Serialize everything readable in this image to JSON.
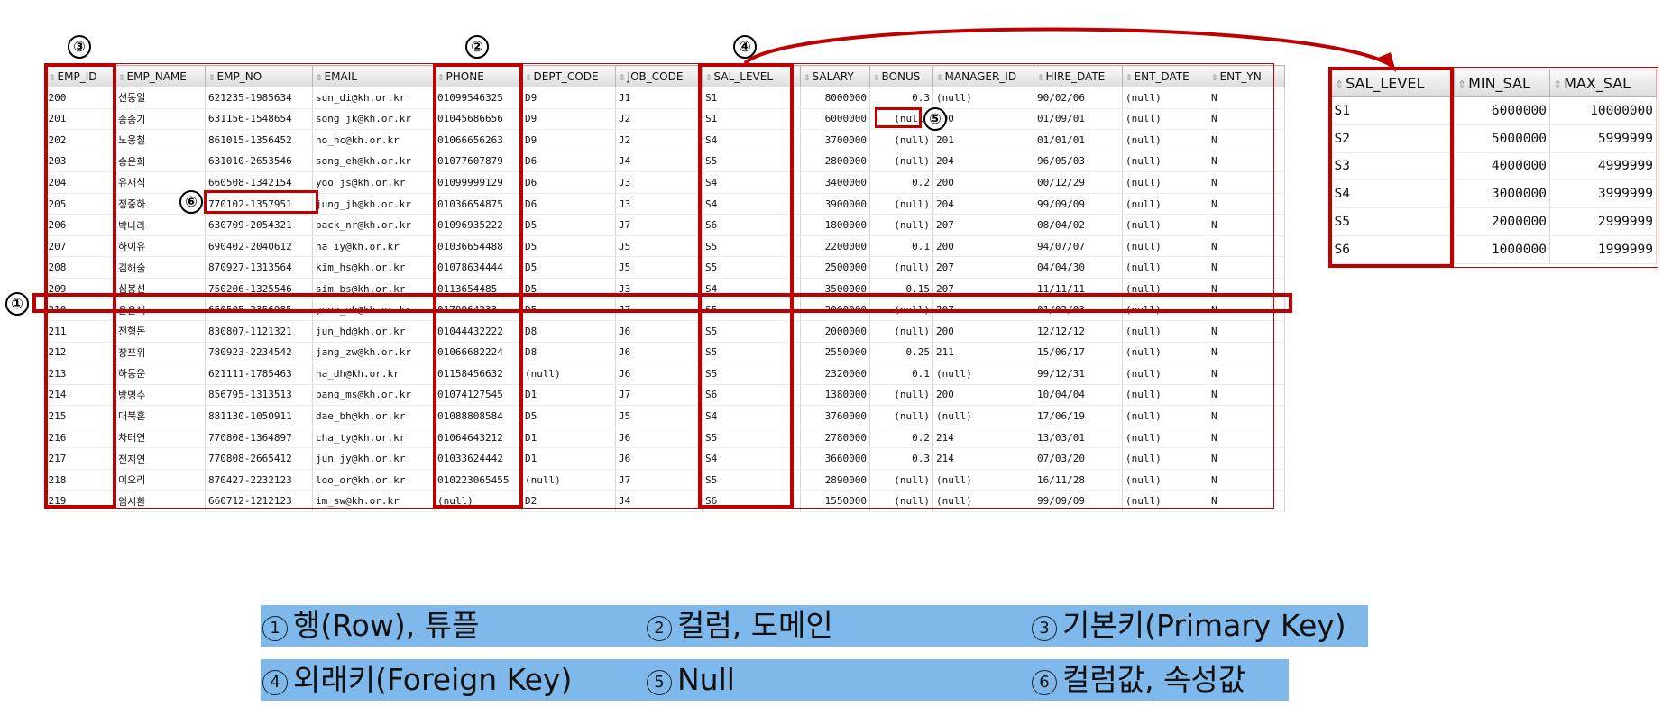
{
  "employee_table": {
    "columns": [
      "EMP_ID",
      "EMP_NAME",
      "EMP_NO",
      "EMAIL",
      "PHONE",
      "DEPT_CODE",
      "JOB_CODE",
      "SAL_LEVEL",
      "SALARY",
      "BONUS",
      "MANAGER_ID",
      "HIRE_DATE",
      "ENT_DATE",
      "ENT_YN"
    ],
    "rows": [
      [
        "200",
        "선동일",
        "621235-1985634",
        "sun_di@kh.or.kr",
        "01099546325",
        "D9",
        "J1",
        "S1",
        "8000000",
        "0.3",
        "(null)",
        "90/02/06",
        "(null)",
        "N"
      ],
      [
        "201",
        "송종기",
        "631156-1548654",
        "song_jk@kh.or.kr",
        "01045686656",
        "D9",
        "J2",
        "S1",
        "6000000",
        "(null)",
        "200",
        "01/09/01",
        "(null)",
        "N"
      ],
      [
        "202",
        "노옹철",
        "861015-1356452",
        "no_hc@kh.or.kr",
        "01066656263",
        "D9",
        "J2",
        "S4",
        "3700000",
        "(null)",
        "201",
        "01/01/01",
        "(null)",
        "N"
      ],
      [
        "203",
        "송은희",
        "631010-2653546",
        "song_eh@kh.or.kr",
        "01077607879",
        "D6",
        "J4",
        "S5",
        "2800000",
        "(null)",
        "204",
        "96/05/03",
        "(null)",
        "N"
      ],
      [
        "204",
        "유재식",
        "660508-1342154",
        "yoo_js@kh.or.kr",
        "01099999129",
        "D6",
        "J3",
        "S4",
        "3400000",
        "0.2",
        "200",
        "00/12/29",
        "(null)",
        "N"
      ],
      [
        "205",
        "정중하",
        "770102-1357951",
        "jung_jh@kh.or.kr",
        "01036654875",
        "D6",
        "J3",
        "S4",
        "3900000",
        "(null)",
        "204",
        "99/09/09",
        "(null)",
        "N"
      ],
      [
        "206",
        "박나라",
        "630709-2054321",
        "pack_nr@kh.or.kr",
        "01096935222",
        "D5",
        "J7",
        "S6",
        "1800000",
        "(null)",
        "207",
        "08/04/02",
        "(null)",
        "N"
      ],
      [
        "207",
        "하이유",
        "690402-2040612",
        "ha_iy@kh.or.kr",
        "01036654488",
        "D5",
        "J5",
        "S5",
        "2200000",
        "0.1",
        "200",
        "94/07/07",
        "(null)",
        "N"
      ],
      [
        "208",
        "김해술",
        "870927-1313564",
        "kim_hs@kh.or.kr",
        "01078634444",
        "D5",
        "J5",
        "S5",
        "2500000",
        "(null)",
        "207",
        "04/04/30",
        "(null)",
        "N"
      ],
      [
        "209",
        "심봉선",
        "750206-1325546",
        "sim_bs@kh.or.kr",
        "0113654485",
        "D5",
        "J3",
        "S4",
        "3500000",
        "0.15",
        "207",
        "11/11/11",
        "(null)",
        "N"
      ],
      [
        "210",
        "윤은해",
        "650505-2356985",
        "youn_eh@kh.or.kr",
        "0179964233",
        "D5",
        "J7",
        "S5",
        "2000000",
        "(null)",
        "207",
        "01/02/03",
        "(null)",
        "N"
      ],
      [
        "211",
        "전형돈",
        "830807-1121321",
        "jun_hd@kh.or.kr",
        "01044432222",
        "D8",
        "J6",
        "S5",
        "2000000",
        "(null)",
        "200",
        "12/12/12",
        "(null)",
        "N"
      ],
      [
        "212",
        "장쯔위",
        "780923-2234542",
        "jang_zw@kh.or.kr",
        "01066682224",
        "D8",
        "J6",
        "S5",
        "2550000",
        "0.25",
        "211",
        "15/06/17",
        "(null)",
        "N"
      ],
      [
        "213",
        "하동운",
        "621111-1785463",
        "ha_dh@kh.or.kr",
        "01158456632",
        "(null)",
        "J6",
        "S5",
        "2320000",
        "0.1",
        "(null)",
        "99/12/31",
        "(null)",
        "N"
      ],
      [
        "214",
        "방명수",
        "856795-1313513",
        "bang_ms@kh.or.kr",
        "01074127545",
        "D1",
        "J7",
        "S6",
        "1380000",
        "(null)",
        "200",
        "10/04/04",
        "(null)",
        "N"
      ],
      [
        "215",
        "대북혼",
        "881130-1050911",
        "dae_bh@kh.or.kr",
        "01088808584",
        "D5",
        "J5",
        "S4",
        "3760000",
        "(null)",
        "(null)",
        "17/06/19",
        "(null)",
        "N"
      ],
      [
        "216",
        "차태연",
        "770808-1364897",
        "cha_ty@kh.or.kr",
        "01064643212",
        "D1",
        "J6",
        "S5",
        "2780000",
        "0.2",
        "214",
        "13/03/01",
        "(null)",
        "N"
      ],
      [
        "217",
        "전지연",
        "770808-2665412",
        "jun_jy@kh.or.kr",
        "01033624442",
        "D1",
        "J6",
        "S4",
        "3660000",
        "0.3",
        "214",
        "07/03/20",
        "(null)",
        "N"
      ],
      [
        "218",
        "이오리",
        "870427-2232123",
        "loo_or@kh.or.kr",
        "010223065455",
        "(null)",
        "J7",
        "S5",
        "2890000",
        "(null)",
        "(null)",
        "16/11/28",
        "(null)",
        "N"
      ],
      [
        "219",
        "임시환",
        "660712-1212123",
        "im_sw@kh.or.kr",
        "(null)",
        "D2",
        "J4",
        "S6",
        "1550000",
        "(null)",
        "(null)",
        "99/09/09",
        "(null)",
        "N"
      ]
    ]
  },
  "salary_grade_table": {
    "columns": [
      "SAL_LEVEL",
      "MIN_SAL",
      "MAX_SAL"
    ],
    "rows": [
      [
        "S1",
        "6000000",
        "10000000"
      ],
      [
        "S2",
        "5000000",
        "5999999"
      ],
      [
        "S3",
        "4000000",
        "4999999"
      ],
      [
        "S4",
        "3000000",
        "3999999"
      ],
      [
        "S5",
        "2000000",
        "2999999"
      ],
      [
        "S6",
        "1000000",
        "1999999"
      ]
    ]
  },
  "badges": {
    "b1": "①",
    "b2": "②",
    "b3": "③",
    "b4": "④",
    "b5": "⑤",
    "b6": "⑥"
  },
  "legend": {
    "row1": [
      {
        "num": "1",
        "text": "행(Row), 튜플"
      },
      {
        "num": "2",
        "text": "컬럼, 도메인"
      },
      {
        "num": "3",
        "text": "기본키(Primary Key)"
      }
    ],
    "row2": [
      {
        "num": "4",
        "text": "외래키(Foreign Key)"
      },
      {
        "num": "5",
        "text": "Null"
      },
      {
        "num": "6",
        "text": "컬럼값, 속성값"
      }
    ]
  },
  "colors": {
    "highlight": "#c00000",
    "legend_bg": "#7fb8ea"
  }
}
